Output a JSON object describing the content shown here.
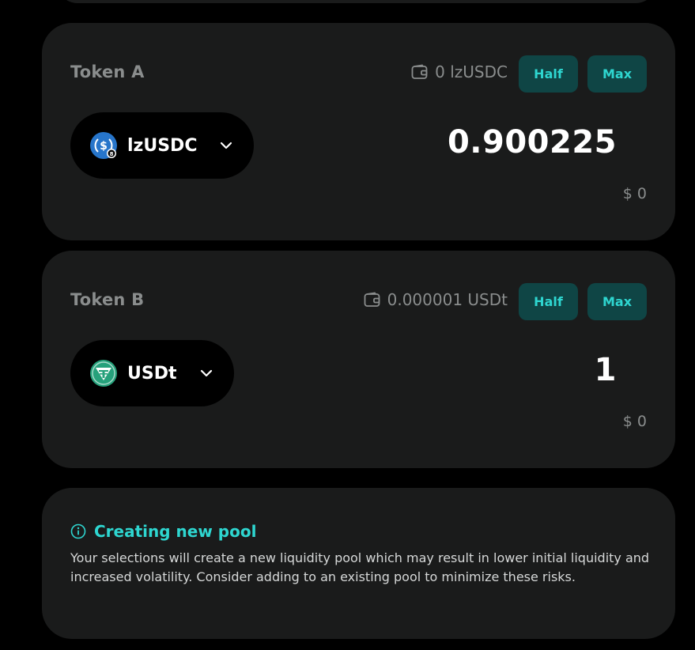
{
  "token_a": {
    "label": "Token A",
    "balance": "0 lzUSDC",
    "half_label": "Half",
    "max_label": "Max",
    "token_name": "lzUSDC",
    "amount": "0.900225",
    "usd_value": "$ 0",
    "icon": "usdc-icon"
  },
  "token_b": {
    "label": "Token B",
    "balance": "0.000001 USDt",
    "half_label": "Half",
    "max_label": "Max",
    "token_name": "USDt",
    "amount": "1",
    "usd_value": "$ 0",
    "icon": "tether-icon"
  },
  "notice": {
    "title": "Creating new pool",
    "text": "Your selections will create a new liquidity pool which may result in lower initial liquidity and increased volatility. Consider adding to an existing pool to minimize these risks.",
    "icon": "info-icon"
  },
  "colors": {
    "accent": "#2ed6d0",
    "button_bg": "#0f4545",
    "card_bg": "#1a1b1b"
  }
}
